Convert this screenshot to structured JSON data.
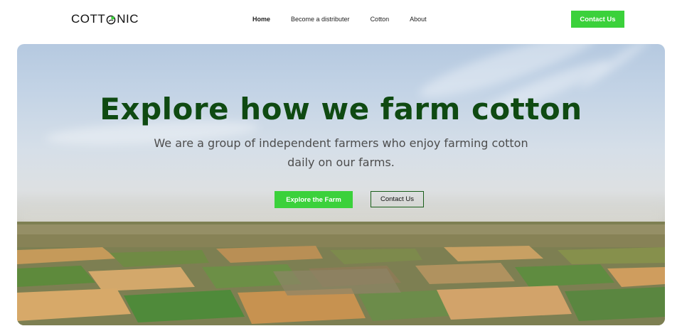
{
  "header": {
    "logo_text_left": "COTT",
    "logo_text_right": "NIC",
    "nav": [
      {
        "label": "Home",
        "active": true
      },
      {
        "label": "Become a distributer",
        "active": false
      },
      {
        "label": "Cotton",
        "active": false
      },
      {
        "label": "About",
        "active": false
      }
    ],
    "contact_label": "Contact Us"
  },
  "hero": {
    "title": "Explore how we farm cotton",
    "subtitle": "We are a group of independent farmers who enjoy farming cotton daily on our farms.",
    "primary_button": "Explore the Farm",
    "secondary_button": "Contact Us",
    "background": "aerial-farmland-photo"
  },
  "colors": {
    "accent_green": "#3bd13b",
    "title_green": "#0f4a12",
    "outline_green": "#1a5e1a"
  }
}
